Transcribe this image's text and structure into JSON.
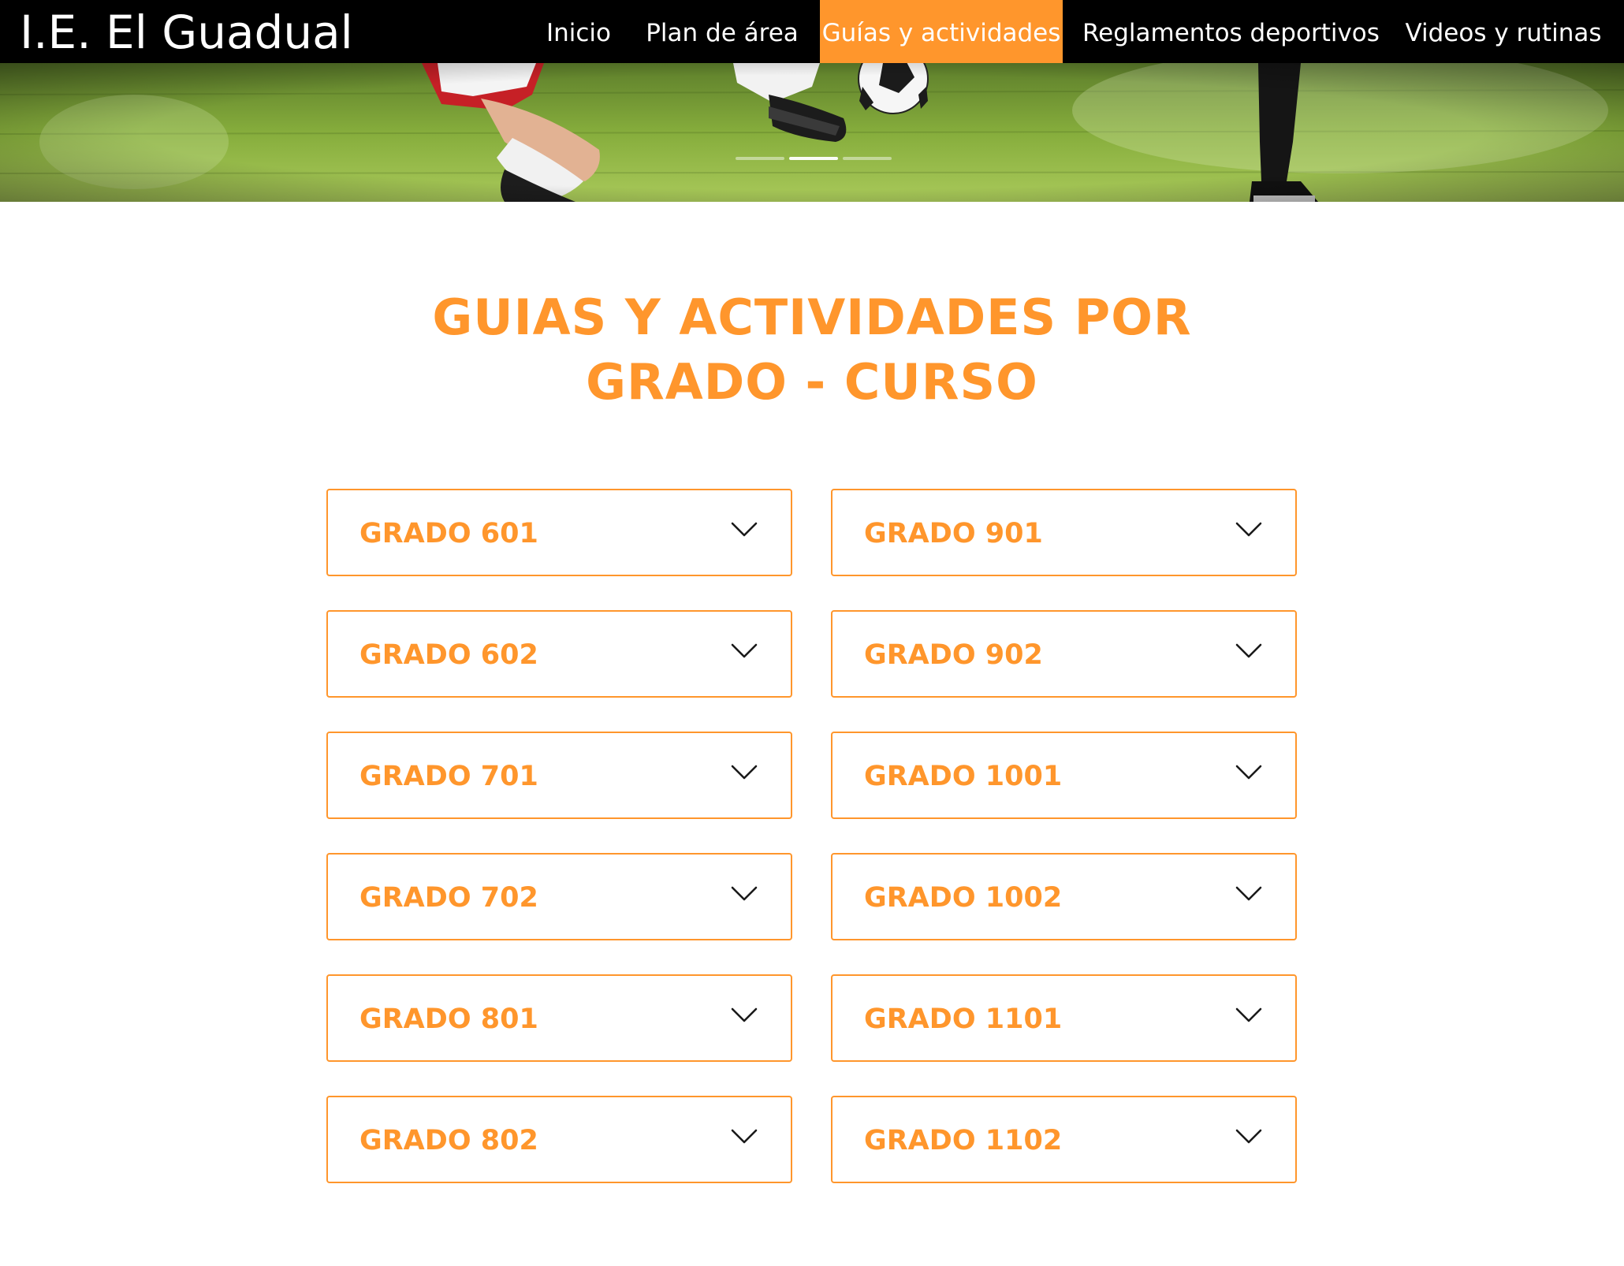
{
  "site": {
    "title": "I.E. El Guadual"
  },
  "nav": {
    "items": [
      {
        "label": "Inicio",
        "active": false
      },
      {
        "label": "Plan de área",
        "active": false
      },
      {
        "label": "Guías y actividades",
        "active": true
      },
      {
        "label": "Reglamentos deportivos",
        "active": false
      },
      {
        "label": "Videos y rutinas",
        "active": false
      }
    ]
  },
  "hero": {
    "image": "soccer-players-kicking-ball-on-grass",
    "slide_count": 3,
    "active_slide": 2
  },
  "main": {
    "heading_line1": "GUIAS Y ACTIVIDADES POR",
    "heading_line2": "GRADO - CURSO"
  },
  "grades": {
    "left": [
      {
        "label": "GRADO 601"
      },
      {
        "label": "GRADO 602"
      },
      {
        "label": "GRADO 701"
      },
      {
        "label": "GRADO 702"
      },
      {
        "label": "GRADO 801"
      },
      {
        "label": "GRADO 802"
      }
    ],
    "right": [
      {
        "label": "GRADO 901"
      },
      {
        "label": "GRADO 902"
      },
      {
        "label": "GRADO 1001"
      },
      {
        "label": "GRADO 1002"
      },
      {
        "label": "GRADO 1101"
      },
      {
        "label": "GRADO 1102"
      }
    ]
  },
  "colors": {
    "accent": "#ff962c",
    "nav_bg": "#000000",
    "nav_text": "#ffffff",
    "page_bg": "#ffffff",
    "chevron": "#1a1a1a"
  },
  "icons": {
    "accordion_toggle": "chevron-down-icon"
  }
}
